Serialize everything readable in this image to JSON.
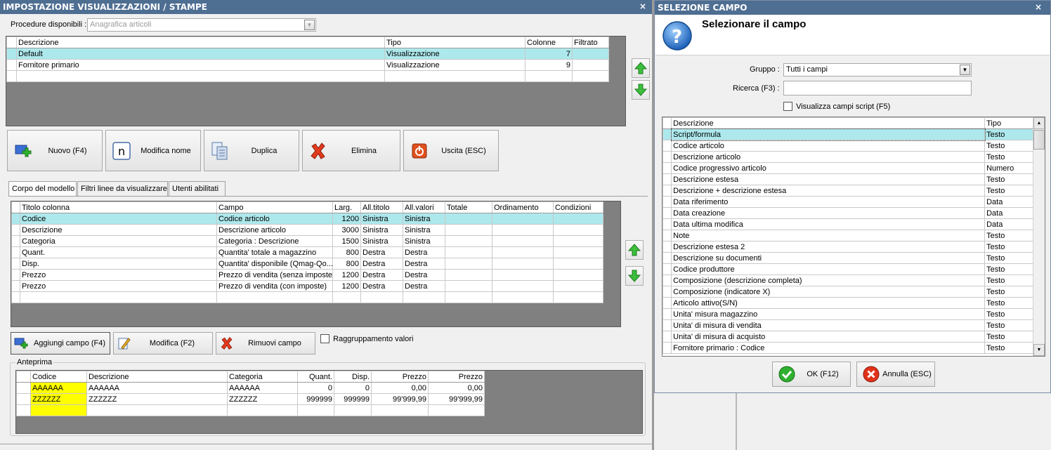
{
  "left_window": {
    "title": "IMPOSTAZIONE VISUALIZZAZIONI / STAMPE",
    "close": "×",
    "procedure_label": "Procedure disponibili :",
    "procedure_value": "Anagrafica articoli",
    "views_table": {
      "headers": [
        "Descrizione",
        "Tipo",
        "Colonne",
        "Filtrato"
      ],
      "rows": [
        {
          "descrizione": "Default",
          "tipo": "Visualizzazione",
          "colonne": "7",
          "filtrato": ""
        },
        {
          "descrizione": "Fornitore primario",
          "tipo": "Visualizzazione",
          "colonne": "9",
          "filtrato": ""
        }
      ]
    },
    "buttons": {
      "nuovo": "Nuovo (F4)",
      "modifica_nome": "Modifica nome",
      "duplica": "Duplica",
      "elimina": "Elimina",
      "uscita": "Uscita (ESC)"
    },
    "tabs": [
      "Corpo del modello",
      "Filtri linee da visualizzare",
      "Utenti abilitati"
    ],
    "columns_table": {
      "headers": [
        "Titolo colonna",
        "Campo",
        "Larg.",
        "All.titolo",
        "All.valori",
        "Totale",
        "Ordinamento",
        "Condizioni"
      ],
      "rows": [
        {
          "titolo": "Codice",
          "campo": "Codice articolo",
          "larg": "1200",
          "all_titolo": "Sinistra",
          "all_valori": "Sinistra",
          "totale": "",
          "ordinamento": "",
          "condizioni": ""
        },
        {
          "titolo": "Descrizione",
          "campo": "Descrizione articolo",
          "larg": "3000",
          "all_titolo": "Sinistra",
          "all_valori": "Sinistra",
          "totale": "",
          "ordinamento": "",
          "condizioni": ""
        },
        {
          "titolo": "Categoria",
          "campo": "Categoria : Descrizione",
          "larg": "1500",
          "all_titolo": "Sinistra",
          "all_valori": "Sinistra",
          "totale": "",
          "ordinamento": "",
          "condizioni": ""
        },
        {
          "titolo": "Quant.",
          "campo": "Quantita' totale a magazzino",
          "larg": "800",
          "all_titolo": "Destra",
          "all_valori": "Destra",
          "totale": "",
          "ordinamento": "",
          "condizioni": ""
        },
        {
          "titolo": "Disp.",
          "campo": "Quantita' disponibile (Qmag-Qo...",
          "larg": "800",
          "all_titolo": "Destra",
          "all_valori": "Destra",
          "totale": "",
          "ordinamento": "",
          "condizioni": ""
        },
        {
          "titolo": "Prezzo",
          "campo": "Prezzo di vendita (senza imposte)",
          "larg": "1200",
          "all_titolo": "Destra",
          "all_valori": "Destra",
          "totale": "",
          "ordinamento": "",
          "condizioni": ""
        },
        {
          "titolo": "Prezzo",
          "campo": "Prezzo di vendita (con imposte)",
          "larg": "1200",
          "all_titolo": "Destra",
          "all_valori": "Destra",
          "totale": "",
          "ordinamento": "",
          "condizioni": ""
        }
      ]
    },
    "field_buttons": {
      "aggiungi": "Aggiungi campo (F4)",
      "modifica": "Modifica (F2)",
      "rimuovi": "Rimuovi campo"
    },
    "raggruppamento_label": "Raggruppamento valori",
    "preview": {
      "label": "Anteprima",
      "headers": [
        "Codice",
        "Descrizione",
        "Categoria",
        "Quant.",
        "Disp.",
        "Prezzo",
        "Prezzo"
      ],
      "rows": [
        [
          "AAAAAA",
          "AAAAAA",
          "AAAAAA",
          "0",
          "0",
          "0,00",
          "0,00"
        ],
        [
          "ZZZZZZ",
          "ZZZZZZ",
          "ZZZZZZ",
          "999999",
          "999999",
          "99'999,99",
          "99'999,99"
        ]
      ]
    }
  },
  "right_window": {
    "title": "SELEZIONE CAMPO",
    "close": "×",
    "heading": "Selezionare il campo",
    "gruppo_label": "Gruppo :",
    "gruppo_value": "Tutti i campi",
    "ricerca_label": "Ricerca (F3) :",
    "ricerca_value": "",
    "script_label": "Visualizza campi script (F5)",
    "fields_table": {
      "headers": [
        "Descrizione",
        "Tipo"
      ],
      "rows": [
        {
          "descrizione": "Script/formula",
          "tipo": "Testo"
        },
        {
          "descrizione": "Codice articolo",
          "tipo": "Testo"
        },
        {
          "descrizione": "Descrizione articolo",
          "tipo": "Testo"
        },
        {
          "descrizione": "Codice progressivo articolo",
          "tipo": "Numero"
        },
        {
          "descrizione": "Descrizione estesa",
          "tipo": "Testo"
        },
        {
          "descrizione": "Descrizione + descrizione estesa",
          "tipo": "Testo"
        },
        {
          "descrizione": "Data riferimento",
          "tipo": "Data"
        },
        {
          "descrizione": "Data creazione",
          "tipo": "Data"
        },
        {
          "descrizione": "Data ultima modifica",
          "tipo": "Data"
        },
        {
          "descrizione": "Note",
          "tipo": "Testo"
        },
        {
          "descrizione": "Descrizione estesa 2",
          "tipo": "Testo"
        },
        {
          "descrizione": "Descrizione su documenti",
          "tipo": "Testo"
        },
        {
          "descrizione": "Codice produttore",
          "tipo": "Testo"
        },
        {
          "descrizione": "Composizione (descrizione completa)",
          "tipo": "Testo"
        },
        {
          "descrizione": "Composizione (indicatore X)",
          "tipo": "Testo"
        },
        {
          "descrizione": "Articolo attivo(S/N)",
          "tipo": "Testo"
        },
        {
          "descrizione": "Unita' misura magazzino",
          "tipo": "Testo"
        },
        {
          "descrizione": "Unita' di misura di vendita",
          "tipo": "Testo"
        },
        {
          "descrizione": "Unita' di misura di acquisto",
          "tipo": "Testo"
        },
        {
          "descrizione": "Fornitore primario : Codice",
          "tipo": "Testo"
        }
      ]
    },
    "ok_label": "OK (F12)",
    "annulla_label": "Annulla (ESC)"
  },
  "colors": {
    "titlebar": "#4e6e92",
    "selected_row": "#ade8ec",
    "preview_code_bg": "#ffff00",
    "grid_backdrop": "#808080"
  },
  "icons": [
    "add-icon",
    "rename-icon",
    "duplicate-icon",
    "delete-icon",
    "exit-icon",
    "arrow-up-icon",
    "arrow-down-icon",
    "edit-icon",
    "question-icon",
    "ok-icon",
    "cancel-icon"
  ]
}
